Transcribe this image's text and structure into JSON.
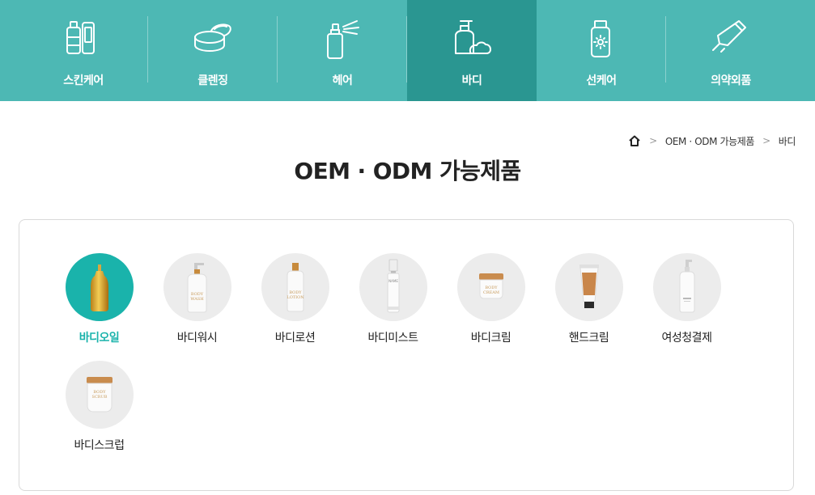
{
  "topnav": {
    "categories": [
      {
        "label": "스킨케어",
        "icon": "skincare-bottles-icon",
        "active": false
      },
      {
        "label": "클렌징",
        "icon": "cleansing-jar-icon",
        "active": false
      },
      {
        "label": "헤어",
        "icon": "hair-spray-icon",
        "active": false
      },
      {
        "label": "바디",
        "icon": "body-pump-bottle-icon",
        "active": true
      },
      {
        "label": "선케어",
        "icon": "suncare-bottle-icon",
        "active": false
      },
      {
        "label": "의약외품",
        "icon": "quasi-drug-tube-icon",
        "active": false
      }
    ]
  },
  "breadcrumb": {
    "home_icon": "home-icon",
    "separator": ">",
    "items": [
      "OEM · ODM 가능제품",
      "바디"
    ]
  },
  "page_title": "OEM · ODM 가능제품",
  "products": [
    {
      "name": "바디오일",
      "active": true,
      "bottle_text": ""
    },
    {
      "name": "바디워시",
      "active": false,
      "bottle_text": "BODY WASH"
    },
    {
      "name": "바디로션",
      "active": false,
      "bottle_text": "BODY LOTION"
    },
    {
      "name": "바디미스트",
      "active": false,
      "bottle_text": "NAME"
    },
    {
      "name": "바디크림",
      "active": false,
      "bottle_text": "BODY CREAM"
    },
    {
      "name": "핸드크림",
      "active": false,
      "bottle_text": ""
    },
    {
      "name": "여성청결제",
      "active": false,
      "bottle_text": ""
    },
    {
      "name": "바디스크럽",
      "active": false,
      "bottle_text": "BODY SCRUB"
    }
  ],
  "colors": {
    "nav_bg": "#4db8b4",
    "nav_active": "#2a9691",
    "accent": "#1ab3ab"
  }
}
